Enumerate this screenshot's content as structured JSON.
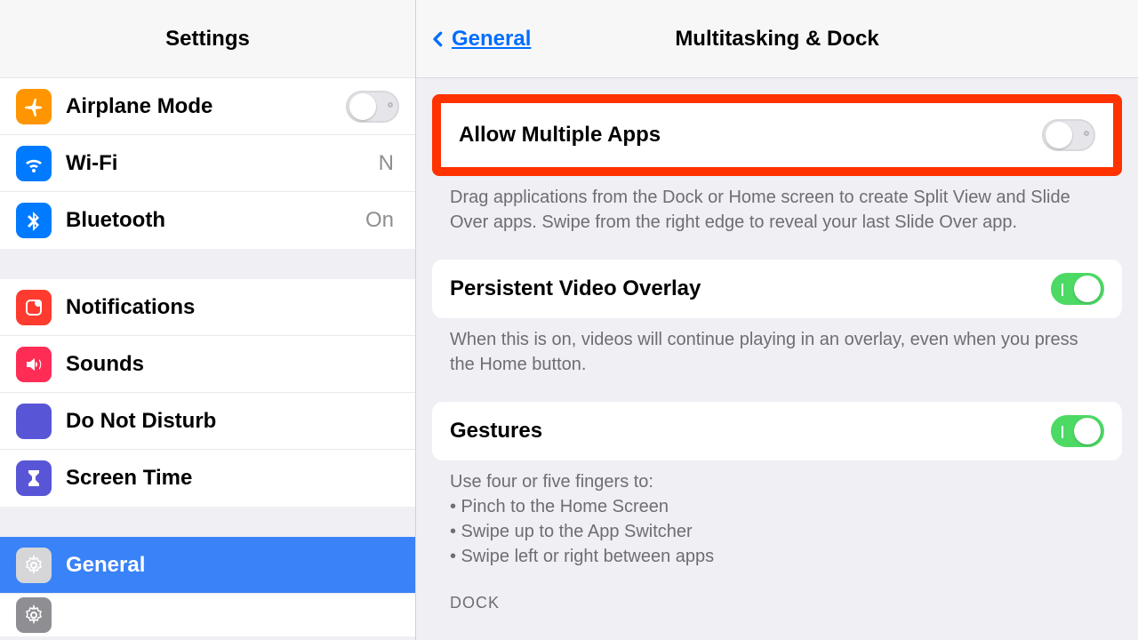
{
  "sidebar": {
    "title": "Settings",
    "groups": [
      {
        "items": [
          {
            "name": "airplane-mode",
            "label": "Airplane Mode",
            "icon": "airplane",
            "bg": "bg-orange",
            "toggle": {
              "on": false
            }
          },
          {
            "name": "wifi",
            "label": "Wi-Fi",
            "icon": "wifi",
            "bg": "bg-blue",
            "trail": "N"
          },
          {
            "name": "bluetooth",
            "label": "Bluetooth",
            "icon": "bluetooth",
            "bg": "bg-blue",
            "trail": "On"
          }
        ]
      },
      {
        "items": [
          {
            "name": "notifications",
            "label": "Notifications",
            "icon": "notifications",
            "bg": "bg-red"
          },
          {
            "name": "sounds",
            "label": "Sounds",
            "icon": "sounds",
            "bg": "bg-pink"
          },
          {
            "name": "dnd",
            "label": "Do Not Disturb",
            "icon": "moon",
            "bg": "bg-indigo"
          },
          {
            "name": "screen-time",
            "label": "Screen Time",
            "icon": "hourglass",
            "bg": "bg-indigo"
          }
        ]
      },
      {
        "items": [
          {
            "name": "general",
            "label": "General",
            "icon": "gear",
            "bg": "bg-gray",
            "selected": true
          }
        ]
      }
    ],
    "cutoffIcon": "gear"
  },
  "detail": {
    "back": "General",
    "title": "Multitasking & Dock",
    "rows": {
      "allow": {
        "label": "Allow Multiple Apps",
        "on": false,
        "desc": "Drag applications from the Dock or Home screen to create Split View and Slide Over apps. Swipe from the right edge to reveal your last Slide Over app."
      },
      "pvo": {
        "label": "Persistent Video Overlay",
        "on": true,
        "desc": "When this is on, videos will continue playing in an overlay, even when you press the Home button."
      },
      "gestures": {
        "label": "Gestures",
        "on": true,
        "desc": "Use four or five fingers to:\n• Pinch to the Home Screen\n• Swipe up to the App Switcher\n• Swipe left or right between apps"
      }
    },
    "dockHeader": "DOCK"
  }
}
